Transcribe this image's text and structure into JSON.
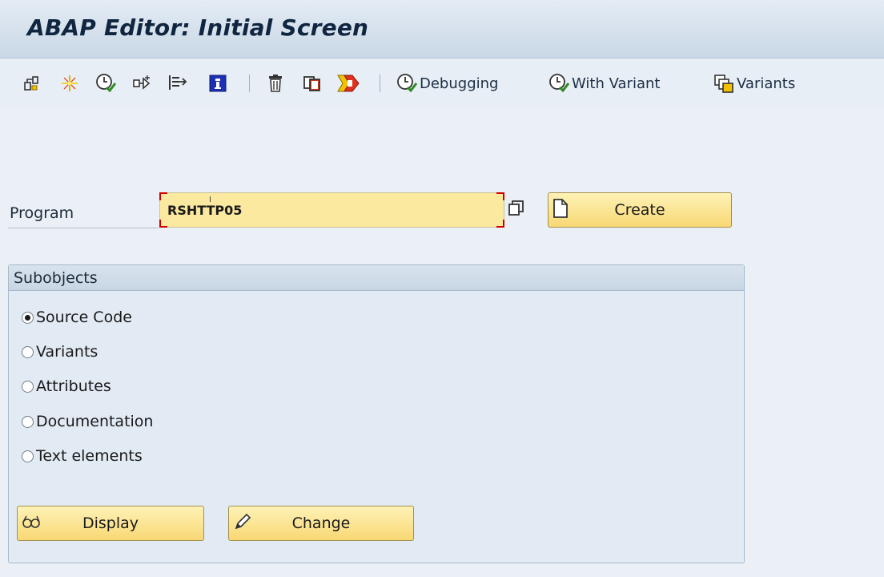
{
  "title": "ABAP Editor: Initial Screen",
  "toolbar": {
    "icons": [
      "other-object-icon",
      "check-icon",
      "activate-icon",
      "where-used-icon",
      "navigate-icon",
      "info-icon",
      "delete-icon",
      "copy-icon",
      "rename-icon"
    ],
    "debugging_label": "Debugging",
    "with_variant_label": "With Variant",
    "variants_label": "Variants"
  },
  "program": {
    "label": "Program",
    "value": "RSHTTP05"
  },
  "create_button": {
    "label": "Create"
  },
  "subobjects": {
    "title": "Subobjects",
    "options": [
      {
        "label": "Source Code",
        "selected": true
      },
      {
        "label": "Variants",
        "selected": false
      },
      {
        "label": "Attributes",
        "selected": false
      },
      {
        "label": "Documentation",
        "selected": false
      },
      {
        "label": "Text elements",
        "selected": false
      }
    ]
  },
  "display_button": {
    "label": "Display"
  },
  "change_button": {
    "label": "Change"
  },
  "colors": {
    "title_text": "#10253f",
    "field_background": "#fbe99f",
    "button_background": "#f8d874",
    "required_marker": "#d10000",
    "check_green": "#2e8b22"
  }
}
